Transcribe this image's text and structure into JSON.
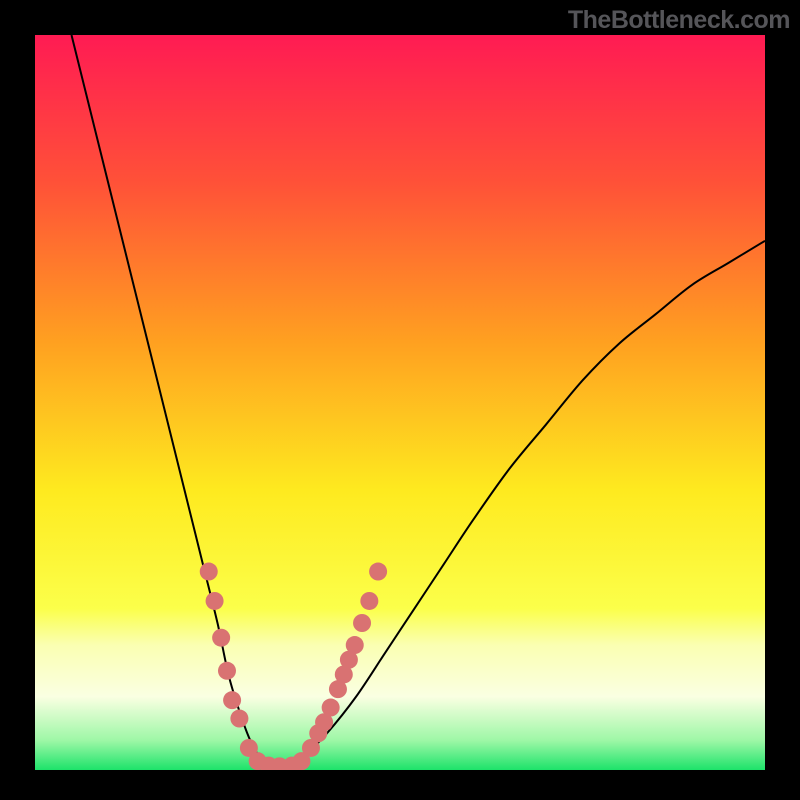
{
  "watermark": "TheBottleneck.com",
  "colors": {
    "frame": "#000000",
    "curve": "#000000",
    "marker": "#d97272",
    "green": "#29e56b"
  },
  "chart_data": {
    "type": "line",
    "title": "",
    "xlabel": "",
    "ylabel": "",
    "xlim": [
      0,
      100
    ],
    "ylim": [
      0,
      100
    ],
    "gradient_stops": [
      {
        "offset": 0.0,
        "color": "#ff1b53"
      },
      {
        "offset": 0.2,
        "color": "#ff5138"
      },
      {
        "offset": 0.42,
        "color": "#ffa120"
      },
      {
        "offset": 0.62,
        "color": "#feea1f"
      },
      {
        "offset": 0.78,
        "color": "#fbff4a"
      },
      {
        "offset": 0.83,
        "color": "#faffb2"
      },
      {
        "offset": 0.9,
        "color": "#faffe2"
      },
      {
        "offset": 0.96,
        "color": "#9df7a6"
      },
      {
        "offset": 1.0,
        "color": "#1de36a"
      }
    ],
    "series": [
      {
        "name": "bottleneck-curve",
        "comment": "y = percent height from bottom; x = percent across",
        "x": [
          5,
          7,
          10,
          13,
          16,
          19,
          21,
          23,
          25,
          26.5,
          28,
          29.5,
          31,
          33,
          35,
          37,
          40,
          44,
          48,
          52,
          56,
          60,
          65,
          70,
          75,
          80,
          85,
          90,
          95,
          100
        ],
        "y": [
          100,
          92,
          80,
          68,
          56,
          44,
          36,
          28,
          20,
          13,
          8,
          4,
          1.5,
          0.5,
          0.5,
          2,
          5,
          10,
          16,
          22,
          28,
          34,
          41,
          47,
          53,
          58,
          62,
          66,
          69,
          72
        ]
      }
    ],
    "markers": {
      "comment": "pink dot cluster near valley, (x%, y%) from bottom-left",
      "points": [
        [
          23.8,
          27
        ],
        [
          24.6,
          23
        ],
        [
          25.5,
          18
        ],
        [
          26.3,
          13.5
        ],
        [
          27.0,
          9.5
        ],
        [
          28.0,
          7
        ],
        [
          29.3,
          3
        ],
        [
          30.5,
          1.2
        ],
        [
          32.0,
          0.6
        ],
        [
          33.5,
          0.5
        ],
        [
          35.2,
          0.6
        ],
        [
          36.5,
          1.2
        ],
        [
          37.8,
          3
        ],
        [
          38.8,
          5
        ],
        [
          39.6,
          6.5
        ],
        [
          40.5,
          8.5
        ],
        [
          41.5,
          11
        ],
        [
          42.3,
          13
        ],
        [
          43.0,
          15
        ],
        [
          43.8,
          17
        ],
        [
          44.8,
          20
        ],
        [
          45.8,
          23
        ],
        [
          47.0,
          27
        ]
      ]
    }
  }
}
